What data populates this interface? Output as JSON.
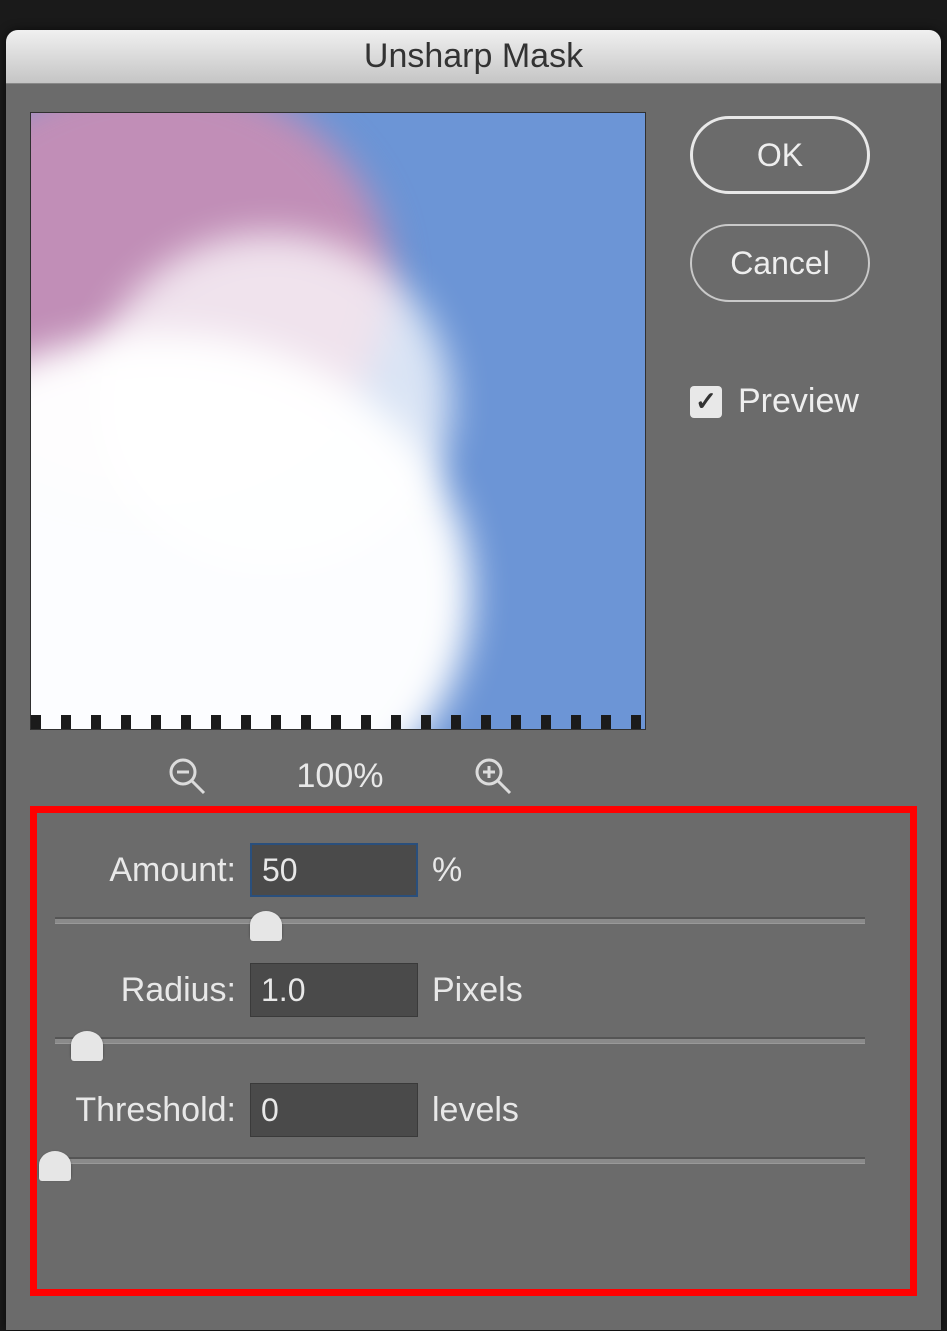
{
  "dialog": {
    "title": "Unsharp Mask",
    "buttons": {
      "ok": "OK",
      "cancel": "Cancel"
    },
    "preview_checkbox_label": "Preview",
    "preview_checked": true
  },
  "zoom": {
    "level_text": "100%"
  },
  "params": {
    "amount": {
      "label": "Amount:",
      "value": "50",
      "suffix": "%",
      "slider_percent": 26
    },
    "radius": {
      "label": "Radius:",
      "value": "1.0",
      "suffix": "Pixels",
      "slider_percent": 4
    },
    "threshold": {
      "label": "Threshold:",
      "value": "0",
      "suffix": "levels",
      "slider_percent": 0
    }
  }
}
